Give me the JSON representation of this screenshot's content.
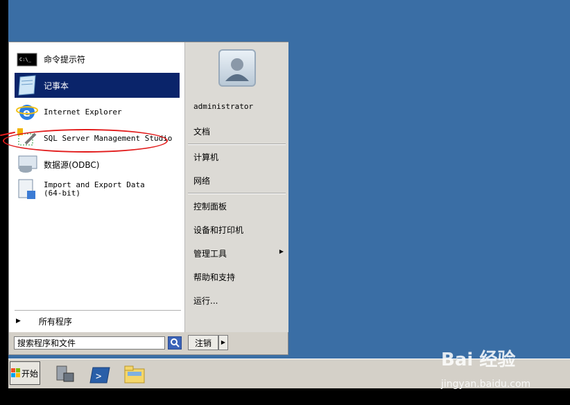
{
  "left_items": [
    {
      "label": "命令提示符",
      "icon": "cmd-icon"
    },
    {
      "label": "记事本",
      "icon": "notepad-icon"
    },
    {
      "label": "Internet Explorer",
      "icon": "ie-icon"
    },
    {
      "label": "SQL Server Management Studio",
      "icon": "ssms-icon"
    },
    {
      "label": "数据源(ODBC)",
      "icon": "odbc-icon"
    },
    {
      "label": "Import and Export Data (64-bit)",
      "icon": "import-export-icon"
    }
  ],
  "all_programs": "所有程序",
  "search": {
    "placeholder": "搜索程序和文件"
  },
  "user": {
    "name": "administrator"
  },
  "right_items": [
    "文档",
    "计算机",
    "网络",
    "控制面板",
    "设备和打印机",
    "管理工具",
    "帮助和支持",
    "运行..."
  ],
  "logoff": "注销",
  "taskbar": {
    "start_label": "开始"
  },
  "watermark": {
    "brand": "Bai 经验",
    "url": "jingyan.baidu.com"
  }
}
